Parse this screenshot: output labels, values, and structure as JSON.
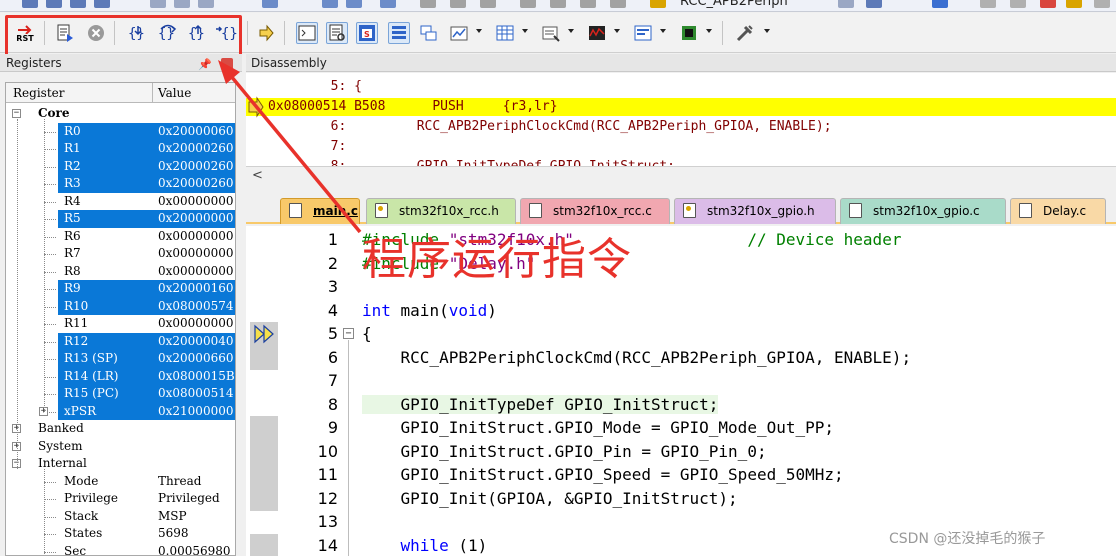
{
  "toolbar_top": {
    "title_partial": "RCC_APB2Periph"
  },
  "toolbar_debug": {
    "reset_label": "RST"
  },
  "registers": {
    "title": "Registers",
    "col_register": "Register",
    "col_value": "Value",
    "groups": [
      {
        "label": "Core",
        "expanded": true
      },
      {
        "label": "Banked",
        "expanded": false
      },
      {
        "label": "System",
        "expanded": false
      },
      {
        "label": "Internal",
        "expanded": true
      }
    ],
    "core": [
      {
        "name": "R0",
        "value": "0x20000060",
        "selected": true
      },
      {
        "name": "R1",
        "value": "0x20000260",
        "selected": true
      },
      {
        "name": "R2",
        "value": "0x20000260",
        "selected": true
      },
      {
        "name": "R3",
        "value": "0x20000260",
        "selected": true
      },
      {
        "name": "R4",
        "value": "0x00000000",
        "selected": false
      },
      {
        "name": "R5",
        "value": "0x20000000",
        "selected": true
      },
      {
        "name": "R6",
        "value": "0x00000000",
        "selected": false
      },
      {
        "name": "R7",
        "value": "0x00000000",
        "selected": false
      },
      {
        "name": "R8",
        "value": "0x00000000",
        "selected": false
      },
      {
        "name": "R9",
        "value": "0x20000160",
        "selected": true
      },
      {
        "name": "R10",
        "value": "0x08000574",
        "selected": true
      },
      {
        "name": "R11",
        "value": "0x00000000",
        "selected": false
      },
      {
        "name": "R12",
        "value": "0x20000040",
        "selected": true
      },
      {
        "name": "R13 (SP)",
        "value": "0x20000660",
        "selected": true
      },
      {
        "name": "R14 (LR)",
        "value": "0x0800015B",
        "selected": true
      },
      {
        "name": "R15 (PC)",
        "value": "0x08000514",
        "selected": true
      },
      {
        "name": "xPSR",
        "value": "0x21000000",
        "selected": true
      }
    ],
    "internal": [
      {
        "name": "Mode",
        "value": "Thread"
      },
      {
        "name": "Privilege",
        "value": "Privileged"
      },
      {
        "name": "Stack",
        "value": "MSP"
      },
      {
        "name": "States",
        "value": "5698"
      },
      {
        "name": "Sec",
        "value": "0.00056980"
      }
    ]
  },
  "disassembly": {
    "title": "Disassembly",
    "lines": [
      {
        "text": "        5: {",
        "color": "#800000",
        "highlight": false
      },
      {
        "text": "0x08000514 B508      PUSH     {r3,lr}",
        "color": "#800000",
        "highlight": true
      },
      {
        "text": "        6:         RCC_APB2PeriphClockCmd(RCC_APB2Periph_GPIOA, ENABLE);",
        "color": "#800000",
        "highlight": false
      },
      {
        "text": "        7:",
        "color": "#800000",
        "highlight": false
      },
      {
        "text": "        8:         GPIO_InitTypeDef GPIO_InitStruct;",
        "color": "#800000",
        "highlight": false
      }
    ],
    "scroll_left": "<"
  },
  "tabs": [
    {
      "label": "main.c",
      "active": true,
      "bg": "#f8c96a",
      "icon": "c"
    },
    {
      "label": "stm32f10x_rcc.h",
      "active": false,
      "bg": "#c9e6a8",
      "icon": "h"
    },
    {
      "label": "stm32f10x_rcc.c",
      "active": false,
      "bg": "#f1a7b0",
      "icon": "c"
    },
    {
      "label": "stm32f10x_gpio.h",
      "active": false,
      "bg": "#dbbce8",
      "icon": "h"
    },
    {
      "label": "stm32f10x_gpio.c",
      "active": false,
      "bg": "#a9dbc9",
      "icon": "c"
    },
    {
      "label": "Delay.c",
      "active": false,
      "bg": "#f9d9a6",
      "icon": "c"
    }
  ],
  "code": {
    "lines": [
      {
        "n": "1",
        "segs": [
          {
            "t": "#include ",
            "c": "cm"
          },
          {
            "t": "\"stm32f10x.h\"",
            "c": "str"
          },
          {
            "t": "                  // Device header",
            "c": "cm"
          }
        ]
      },
      {
        "n": "2",
        "segs": [
          {
            "t": "#include ",
            "c": "cm"
          },
          {
            "t": "\"Delay.h\"",
            "c": "str"
          }
        ]
      },
      {
        "n": "3",
        "segs": []
      },
      {
        "n": "4",
        "segs": [
          {
            "t": "int",
            "c": "kw"
          },
          {
            "t": " main(",
            "c": ""
          },
          {
            "t": "void",
            "c": "kw"
          },
          {
            "t": ")",
            "c": ""
          }
        ]
      },
      {
        "n": "5",
        "segs": [
          {
            "t": "{",
            "c": ""
          }
        ]
      },
      {
        "n": "6",
        "segs": [
          {
            "t": "    RCC_APB2PeriphClockCmd(RCC_APB2Periph_GPIOA, ENABLE);",
            "c": ""
          }
        ]
      },
      {
        "n": "7",
        "segs": []
      },
      {
        "n": "8",
        "segs": [
          {
            "t": "    GPIO_InitTypeDef GPIO_InitStruct;",
            "c": ""
          }
        ],
        "hl": true
      },
      {
        "n": "9",
        "segs": [
          {
            "t": "    GPIO_InitStruct.GPIO_Mode = GPIO_Mode_Out_PP;",
            "c": ""
          }
        ]
      },
      {
        "n": "10",
        "segs": [
          {
            "t": "    GPIO_InitStruct.GPIO_Pin = GPIO_Pin_0;",
            "c": ""
          }
        ]
      },
      {
        "n": "11",
        "segs": [
          {
            "t": "    GPIO_InitStruct.GPIO_Speed = GPIO_Speed_50MHz;",
            "c": ""
          }
        ]
      },
      {
        "n": "12",
        "segs": [
          {
            "t": "    GPIO_Init(GPIOA, &GPIO_InitStruct);",
            "c": ""
          }
        ]
      },
      {
        "n": "13",
        "segs": []
      },
      {
        "n": "14",
        "segs": [
          {
            "t": "    ",
            "c": ""
          },
          {
            "t": "while",
            "c": "kw"
          },
          {
            "t": " (1)",
            "c": ""
          }
        ]
      }
    ]
  },
  "annotation": {
    "text": "程序运行指令",
    "color": "#e8322b"
  },
  "watermark": "CSDN @还没掉毛的猴子"
}
